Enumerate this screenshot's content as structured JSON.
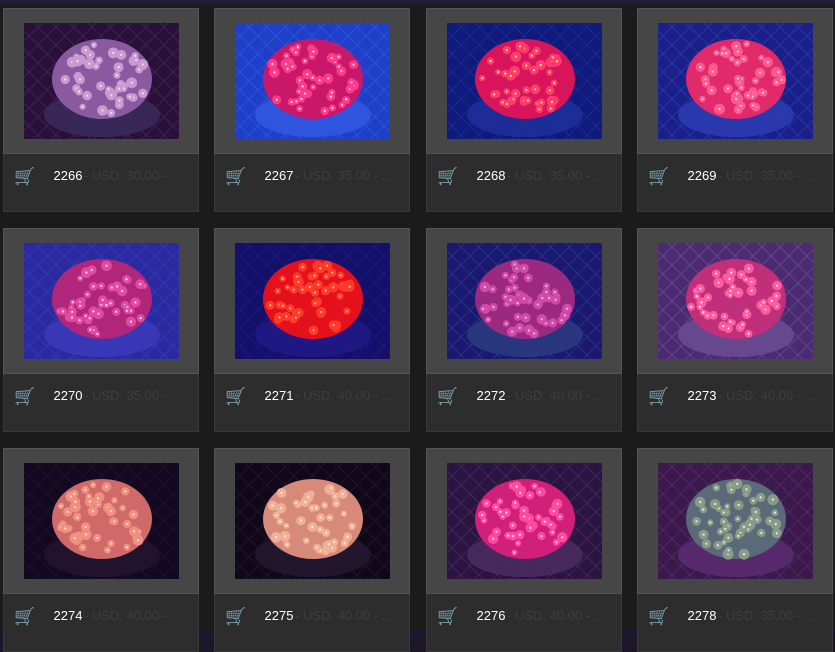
{
  "gallery": {
    "items": [
      {
        "id": "2266",
        "price": "- USD. 30.00 - ...",
        "photo": {
          "bg": "#2a1038",
          "tank": "#3a2a5a",
          "coral": "#8a5aa0",
          "polyp": "#c79ad0",
          "center": "#f0d8f0"
        }
      },
      {
        "id": "2267",
        "price": "- USD. 35.00 - ...",
        "photo": {
          "bg": "#1f3fc8",
          "tank": "#3157e0",
          "coral": "#c8186a",
          "polyp": "#ff3a8a",
          "center": "#ffd0e0"
        }
      },
      {
        "id": "2268",
        "price": "- USD. 35.00 - ...",
        "photo": {
          "bg": "#0f1a7a",
          "tank": "#1d2f9a",
          "coral": "#d8145a",
          "polyp": "#ff3a70",
          "center": "#ffe06a"
        }
      },
      {
        "id": "2269",
        "price": "- USD. 35.00 - ...",
        "photo": {
          "bg": "#1b1f88",
          "tank": "#2b3bb0",
          "coral": "#e02a6a",
          "polyp": "#ff5a90",
          "center": "#ffd0e0"
        }
      },
      {
        "id": "2270",
        "price": "- USD. 35.00 - ...",
        "photo": {
          "bg": "#2a2aa0",
          "tank": "#3a3ab8",
          "coral": "#b0267a",
          "polyp": "#e24aa0",
          "center": "#ffd0ff"
        }
      },
      {
        "id": "2271",
        "price": "- USD. 40.00 - ...",
        "photo": {
          "bg": "#14106a",
          "tank": "#201a86",
          "coral": "#e4101c",
          "polyp": "#ff3a2a",
          "center": "#ffb08a"
        }
      },
      {
        "id": "2272",
        "price": "- USD. 40.00 - ...",
        "photo": {
          "bg": "#1a1870",
          "tank": "#2a3a80",
          "coral": "#9a2a80",
          "polyp": "#d24aa8",
          "center": "#f0b0e0"
        }
      },
      {
        "id": "2273",
        "price": "- USD. 40.00 - ...",
        "photo": {
          "bg": "#4a2a70",
          "tank": "#6a4a90",
          "coral": "#c0307a",
          "polyp": "#ff5aa0",
          "center": "#ffd8f0"
        }
      },
      {
        "id": "2274",
        "price": "- USD. 40.00 - ...",
        "photo": {
          "bg": "#120820",
          "tank": "#241430",
          "coral": "#d06a6a",
          "polyp": "#f09080",
          "center": "#ffe0c0"
        }
      },
      {
        "id": "2275",
        "price": "- USD. 40.00 - ...",
        "photo": {
          "bg": "#100818",
          "tank": "#241830",
          "coral": "#d88a7a",
          "polyp": "#f0b098",
          "center": "#ffe8d0"
        }
      },
      {
        "id": "2276",
        "price": "- USD. 40.00 - ...",
        "photo": {
          "bg": "#2a1440",
          "tank": "#4a2a60",
          "coral": "#d0207a",
          "polyp": "#ff4aa0",
          "center": "#ffd0f0"
        }
      },
      {
        "id": "2278",
        "price": "- USD. 35.00 - ...",
        "photo": {
          "bg": "#3a1a4a",
          "tank": "#5a2a70",
          "coral": "#5a6a78",
          "polyp": "#8a9a8a",
          "center": "#d0f0c0"
        }
      }
    ]
  }
}
